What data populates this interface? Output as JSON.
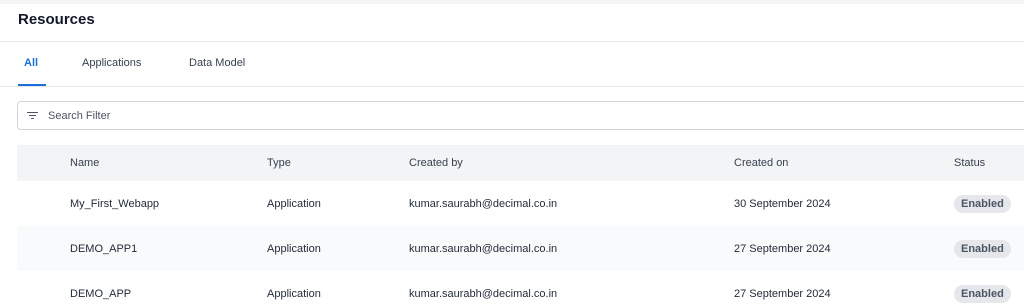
{
  "header": {
    "title": "Resources"
  },
  "tabs": [
    {
      "label": "All",
      "active": true
    },
    {
      "label": "Applications",
      "active": false
    },
    {
      "label": "Data Model",
      "active": false
    }
  ],
  "search": {
    "placeholder": "Search Filter",
    "icon": "filter-icon"
  },
  "table": {
    "columns": [
      "Name",
      "Type",
      "Created by",
      "Created on",
      "Status"
    ],
    "rows": [
      {
        "name": "My_First_Webapp",
        "type": "Application",
        "created_by": "kumar.saurabh@decimal.co.in",
        "created_on": "30 September 2024",
        "status": "Enabled"
      },
      {
        "name": "DEMO_APP1",
        "type": "Application",
        "created_by": "kumar.saurabh@decimal.co.in",
        "created_on": "27 September 2024",
        "status": "Enabled"
      },
      {
        "name": "DEMO_APP",
        "type": "Application",
        "created_by": "kumar.saurabh@decimal.co.in",
        "created_on": "27 September 2024",
        "status": "Enabled"
      }
    ]
  },
  "colors": {
    "accent": "#1d6fd8",
    "header_bg": "#f3f4f6",
    "badge_bg": "#e5e7eb"
  }
}
